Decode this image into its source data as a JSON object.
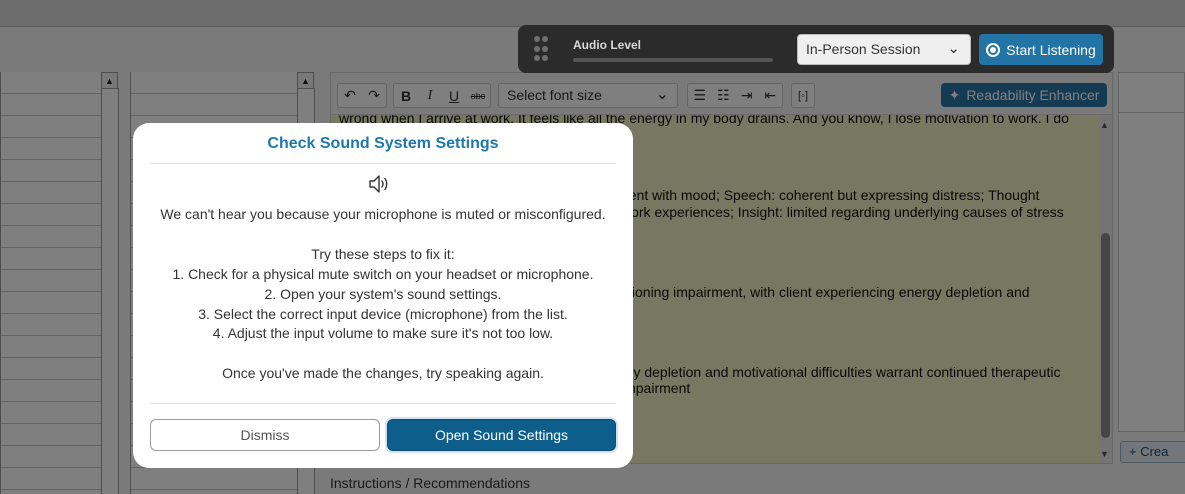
{
  "audio_bar": {
    "level_label": "Audio Level",
    "level_value": 0,
    "session_select_value": "In-Person Session",
    "start_listening_label": "Start Listening"
  },
  "editor": {
    "font_size_placeholder": "Select font size",
    "readability_label": "Readability Enhancer",
    "text_lines": [
      "wrong when I arrive at work. It feels like all the energy in my body drains. And you know, I lose motivation to work. I do",
      "uent with mood; Speech: coherent but expressing distress; Thought",
      "work experiences; Insight: limited regarding underlying causes of stress",
      "ctioning impairment, with client experiencing energy depletion and",
      "rgy depletion and motivational difficulties warrant continued therapeutic",
      " impairment"
    ],
    "section_label": "Instructions / Recommendations"
  },
  "right_panel": {
    "create_label": "+ Crea"
  },
  "modal": {
    "title": "Check Sound System Settings",
    "message": "We can't hear you because your microphone is muted or misconfigured.",
    "steps_intro": "Try these steps to fix it:",
    "steps": [
      "1. Check for a physical mute switch on your headset or microphone.",
      "2. Open your system's sound settings.",
      "3. Select the correct input device (microphone) from the list.",
      "4. Adjust the input volume to make sure it's not too low."
    ],
    "closing": "Once you've made the changes, try speaking again.",
    "dismiss_label": "Dismiss",
    "open_settings_label": "Open Sound Settings"
  },
  "colors": {
    "accent": "#1f78ad",
    "primary_button": "#0e5e8c",
    "editor_background": "#eff0c3",
    "audio_bar_background": "#2b2b2b"
  },
  "icons": {
    "speaker": "speaker-icon",
    "grip": "drag-grip-icon",
    "listen": "record-icon",
    "readability": "sparkle-icon"
  }
}
